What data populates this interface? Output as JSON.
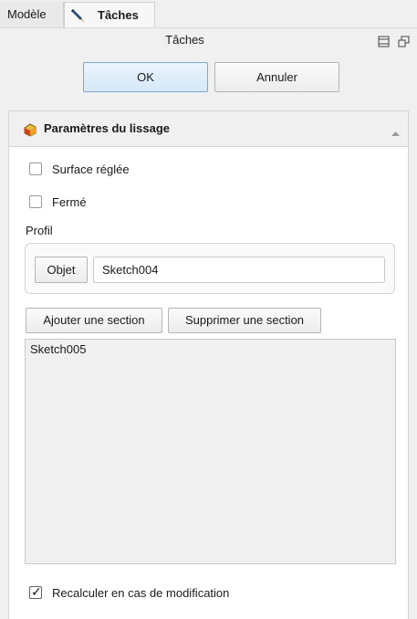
{
  "tabs": {
    "model_label": "Modèle",
    "tasks_label": "Tâches"
  },
  "panel": {
    "title": "Tâches",
    "ok_label": "OK",
    "cancel_label": "Annuler"
  },
  "loft": {
    "group_title": "Paramètres du lissage",
    "ruled_label": "Surface réglée",
    "ruled_checked": false,
    "closed_label": "Fermé",
    "closed_checked": false,
    "profile_label": "Profil",
    "object_button": "Objet",
    "profile_value": "Sketch004",
    "add_section_label": "Ajouter une section",
    "remove_section_label": "Supprimer une section",
    "sections": [
      "Sketch005"
    ],
    "recompute_label": "Recalculer en cas de modification",
    "recompute_checked": true
  },
  "icons": {
    "tasks_tab": "pencil-icon",
    "group": "loft-icon",
    "collapse": "chevron-up-icon",
    "dock": "dock-icon",
    "float": "float-icon"
  },
  "colors": {
    "ok_button_bg": "#dbeaf8",
    "ok_button_border": "#7aa9d8",
    "group_header_bg": "#f0f0f0",
    "list_bg": "#f0f0f0"
  }
}
